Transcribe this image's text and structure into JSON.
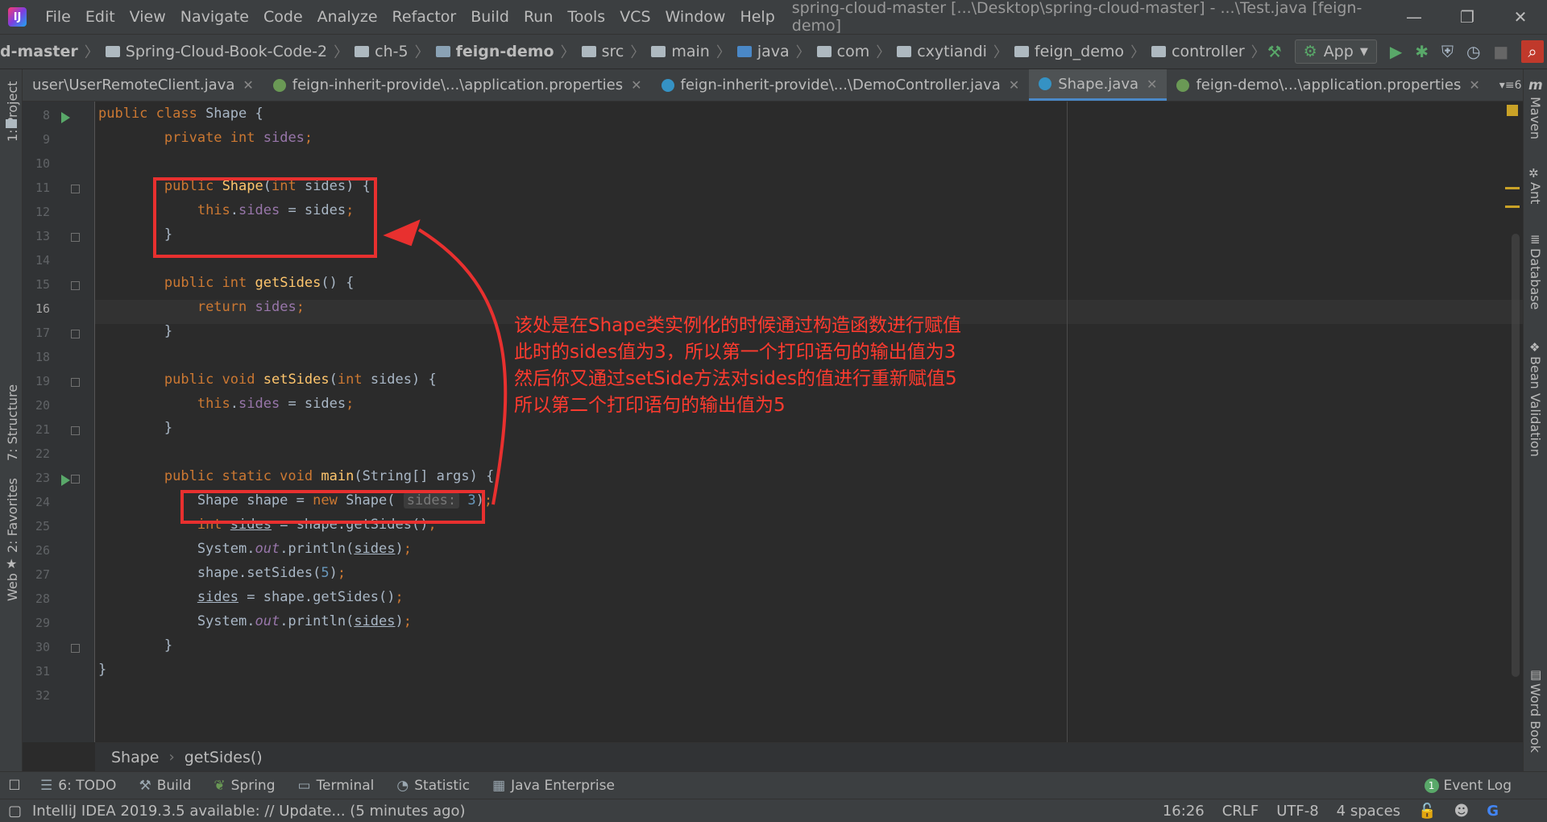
{
  "menubar": {
    "items": [
      "File",
      "Edit",
      "View",
      "Navigate",
      "Code",
      "Analyze",
      "Refactor",
      "Build",
      "Run",
      "Tools",
      "VCS",
      "Window",
      "Help"
    ],
    "title": "spring-cloud-master [...\\Desktop\\spring-cloud-master] - ...\\Test.java [feign-demo]"
  },
  "navbar": {
    "crumbs": [
      "d-master",
      "Spring-Cloud-Book-Code-2",
      "ch-5",
      "feign-demo",
      "src",
      "main",
      "java",
      "com",
      "cxytiandi",
      "feign_demo",
      "controller"
    ],
    "run_config": "App"
  },
  "tabs": [
    {
      "label": "user\\UserRemoteClient.java",
      "active": false
    },
    {
      "label": "feign-inherit-provide\\...\\application.properties",
      "active": false
    },
    {
      "label": "feign-inherit-provide\\...\\DemoController.java",
      "active": false
    },
    {
      "label": "Shape.java",
      "active": true
    },
    {
      "label": "feign-demo\\...\\application.properties",
      "active": false
    }
  ],
  "tabs_overflow": "6",
  "left_tools": [
    "1: Project",
    "7: Structure",
    "2: Favorites",
    "Web"
  ],
  "right_tools": [
    "Maven",
    "Ant",
    "Database",
    "Bean Validation",
    "Word Book"
  ],
  "editor": {
    "line_numbers": [
      "8",
      "9",
      "10",
      "11",
      "12",
      "13",
      "14",
      "15",
      "16",
      "17",
      "18",
      "19",
      "20",
      "21",
      "22",
      "23",
      "24",
      "25",
      "26",
      "27",
      "28",
      "29",
      "30",
      "31",
      "32"
    ],
    "current_line": "16",
    "param_hint": "sides:"
  },
  "annotation": {
    "lines": [
      "该处是在Shape类实例化的时候通过构造函数进行赋值",
      "此时的sides值为3，所以第一个打印语句的输出值为3",
      "然后你又通过setSide方法对sides的值进行重新赋值5",
      "所以第二个打印语句的输出值为5"
    ],
    "color": "#e8302f"
  },
  "editor_breadcrumb": [
    "Shape",
    "getSides()"
  ],
  "tool_windows": [
    {
      "label": "6: TODO",
      "icon": "list-icon"
    },
    {
      "label": "Build",
      "icon": "hammer-icon"
    },
    {
      "label": "Spring",
      "icon": "leaf-icon"
    },
    {
      "label": "Terminal",
      "icon": "terminal-icon"
    },
    {
      "label": "Statistic",
      "icon": "statistic-icon"
    },
    {
      "label": "Java Enterprise",
      "icon": "enterprise-icon"
    }
  ],
  "event_log": {
    "label": "Event Log",
    "count": "1"
  },
  "status": {
    "message": "IntelliJ IDEA 2019.3.5 available: // Update... (5 minutes ago)",
    "position": "16:26",
    "line_sep": "CRLF",
    "encoding": "UTF-8",
    "indent": "4 spaces"
  },
  "colors": {
    "keyword": "#cc7832",
    "field": "#9876aa",
    "method": "#ffc66d",
    "number": "#6897bb",
    "accent": "#4a88c7"
  }
}
